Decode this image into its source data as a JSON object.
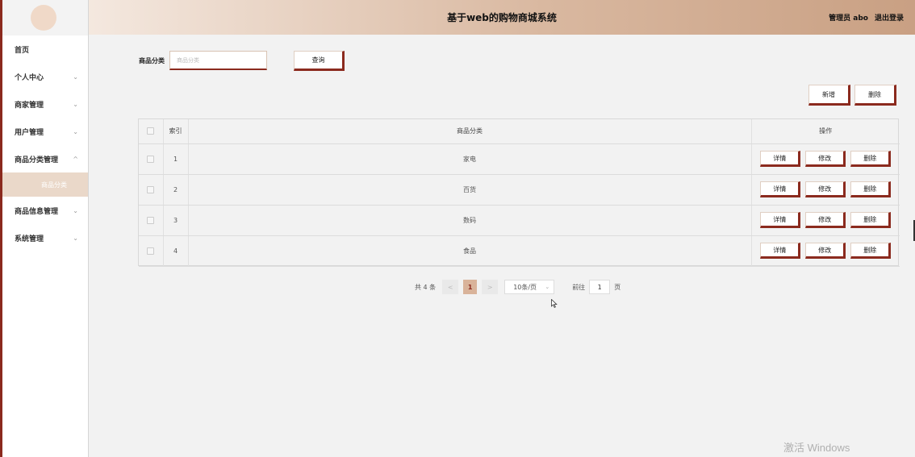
{
  "header": {
    "title": "基于web的购物商城系统",
    "user": "管理员 abo",
    "logout": "退出登录"
  },
  "sidebar": {
    "items": [
      {
        "label": "首页",
        "expandable": false
      },
      {
        "label": "个人中心",
        "expandable": true,
        "expanded": false
      },
      {
        "label": "商家管理",
        "expandable": true,
        "expanded": false
      },
      {
        "label": "用户管理",
        "expandable": true,
        "expanded": false
      },
      {
        "label": "商品分类管理",
        "expandable": true,
        "expanded": true
      },
      {
        "label": "商品信息管理",
        "expandable": true,
        "expanded": false
      },
      {
        "label": "系统管理",
        "expandable": true,
        "expanded": false
      }
    ],
    "subitem": "商品分类",
    "chevron_down": "⌄",
    "chevron_up": "^"
  },
  "search": {
    "label": "商品分类",
    "placeholder": "商品分类",
    "button": "查询"
  },
  "toolbar": {
    "add": "新增",
    "delete": "删除"
  },
  "table": {
    "headers": [
      "",
      "索引",
      "商品分类",
      "操作"
    ],
    "rows": [
      {
        "index": "1",
        "category": "家电"
      },
      {
        "index": "2",
        "category": "百货"
      },
      {
        "index": "3",
        "category": "数码"
      },
      {
        "index": "4",
        "category": "食品"
      }
    ],
    "actions": {
      "detail": "详情",
      "edit": "修改",
      "delete": "删除"
    }
  },
  "pagination": {
    "total": "共 4 条",
    "prev": "<",
    "current": "1",
    "next": ">",
    "page_size": "10条/页",
    "goto_prefix": "前往",
    "goto_value": "1",
    "goto_suffix": "页"
  },
  "watermark": "激活 Windows",
  "colors": {
    "accent": "#8b2a1e",
    "active_page": "#d9b39a",
    "submenu_bg": "#ead8c9"
  }
}
